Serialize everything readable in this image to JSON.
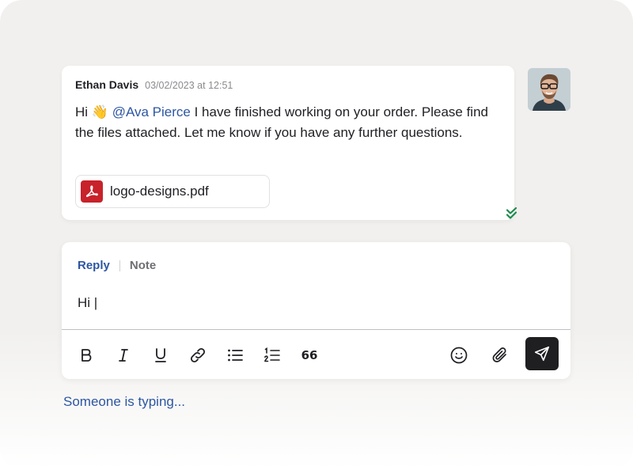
{
  "message": {
    "author": "Ethan Davis",
    "timestamp": "03/02/2023 at 12:51",
    "greeting": "Hi",
    "emoji": "👋",
    "mention": "@Ava Pierce",
    "text": "I have finished working on your order. Please find the files attached. Let me know if you have any further questions.",
    "attachment": {
      "file_name": "logo-designs.pdf",
      "icon": "pdf-icon"
    },
    "status_icon": "double-check-icon",
    "avatar_icon": "user-avatar"
  },
  "composer": {
    "tabs": [
      {
        "label": "Reply"
      },
      {
        "label": "Note"
      }
    ],
    "input_value": "Hi |",
    "toolbar": {
      "items": [
        "bold-icon",
        "italic-icon",
        "underline-icon",
        "link-icon",
        "bullet-list-icon",
        "numbered-list-icon",
        "quote-icon",
        "emoji-icon",
        "attach-icon",
        "send-icon"
      ],
      "quote_label": "66"
    }
  },
  "typing_indicator": "Someone is typing...",
  "colors": {
    "accent": "#2d56a2",
    "pdf": "#c8222b",
    "send_button": "#1f1f21",
    "read_check": "#1e8a4c"
  }
}
